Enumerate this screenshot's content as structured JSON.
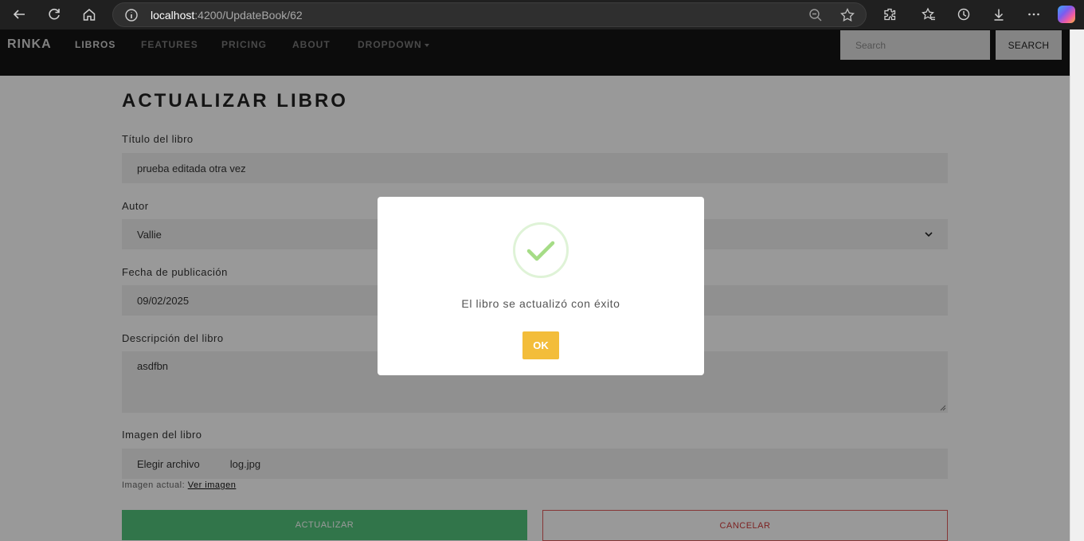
{
  "browser": {
    "url_host": "localhost",
    "url_rest": ":4200/UpdateBook/62"
  },
  "nav": {
    "brand": "RINKA",
    "links": [
      "LIBROS",
      "FEATURES",
      "PRICING",
      "ABOUT",
      "DROPDOWN"
    ],
    "search_placeholder": "Search",
    "search_button": "SEARCH"
  },
  "form": {
    "title": "ACTUALIZAR LIBRO",
    "book_title_label": "Título del libro",
    "book_title_value": "prueba editada otra vez",
    "author_label": "Autor",
    "author_value": "Vallie",
    "date_label": "Fecha de publicación",
    "date_value": "09/02/2025",
    "description_label": "Descripción del libro",
    "description_value": "asdfbn",
    "image_label": "Imagen del libro",
    "file_button": "Elegir archivo",
    "file_name": "log.jpg",
    "current_image_label": "Imagen actual:",
    "current_image_link": "Ver imagen",
    "update_button": "ACTUALIZAR",
    "cancel_button": "CANCELAR"
  },
  "modal": {
    "message": "El libro se actualizó con éxito",
    "ok_button": "OK",
    "icon": "success-check-icon"
  },
  "colors": {
    "nav_bg": "#151515",
    "update_green": "#52c47c",
    "cancel_red": "#e05a5a",
    "ok_yellow": "#f3bd3a",
    "check_green": "#a5dc86"
  }
}
